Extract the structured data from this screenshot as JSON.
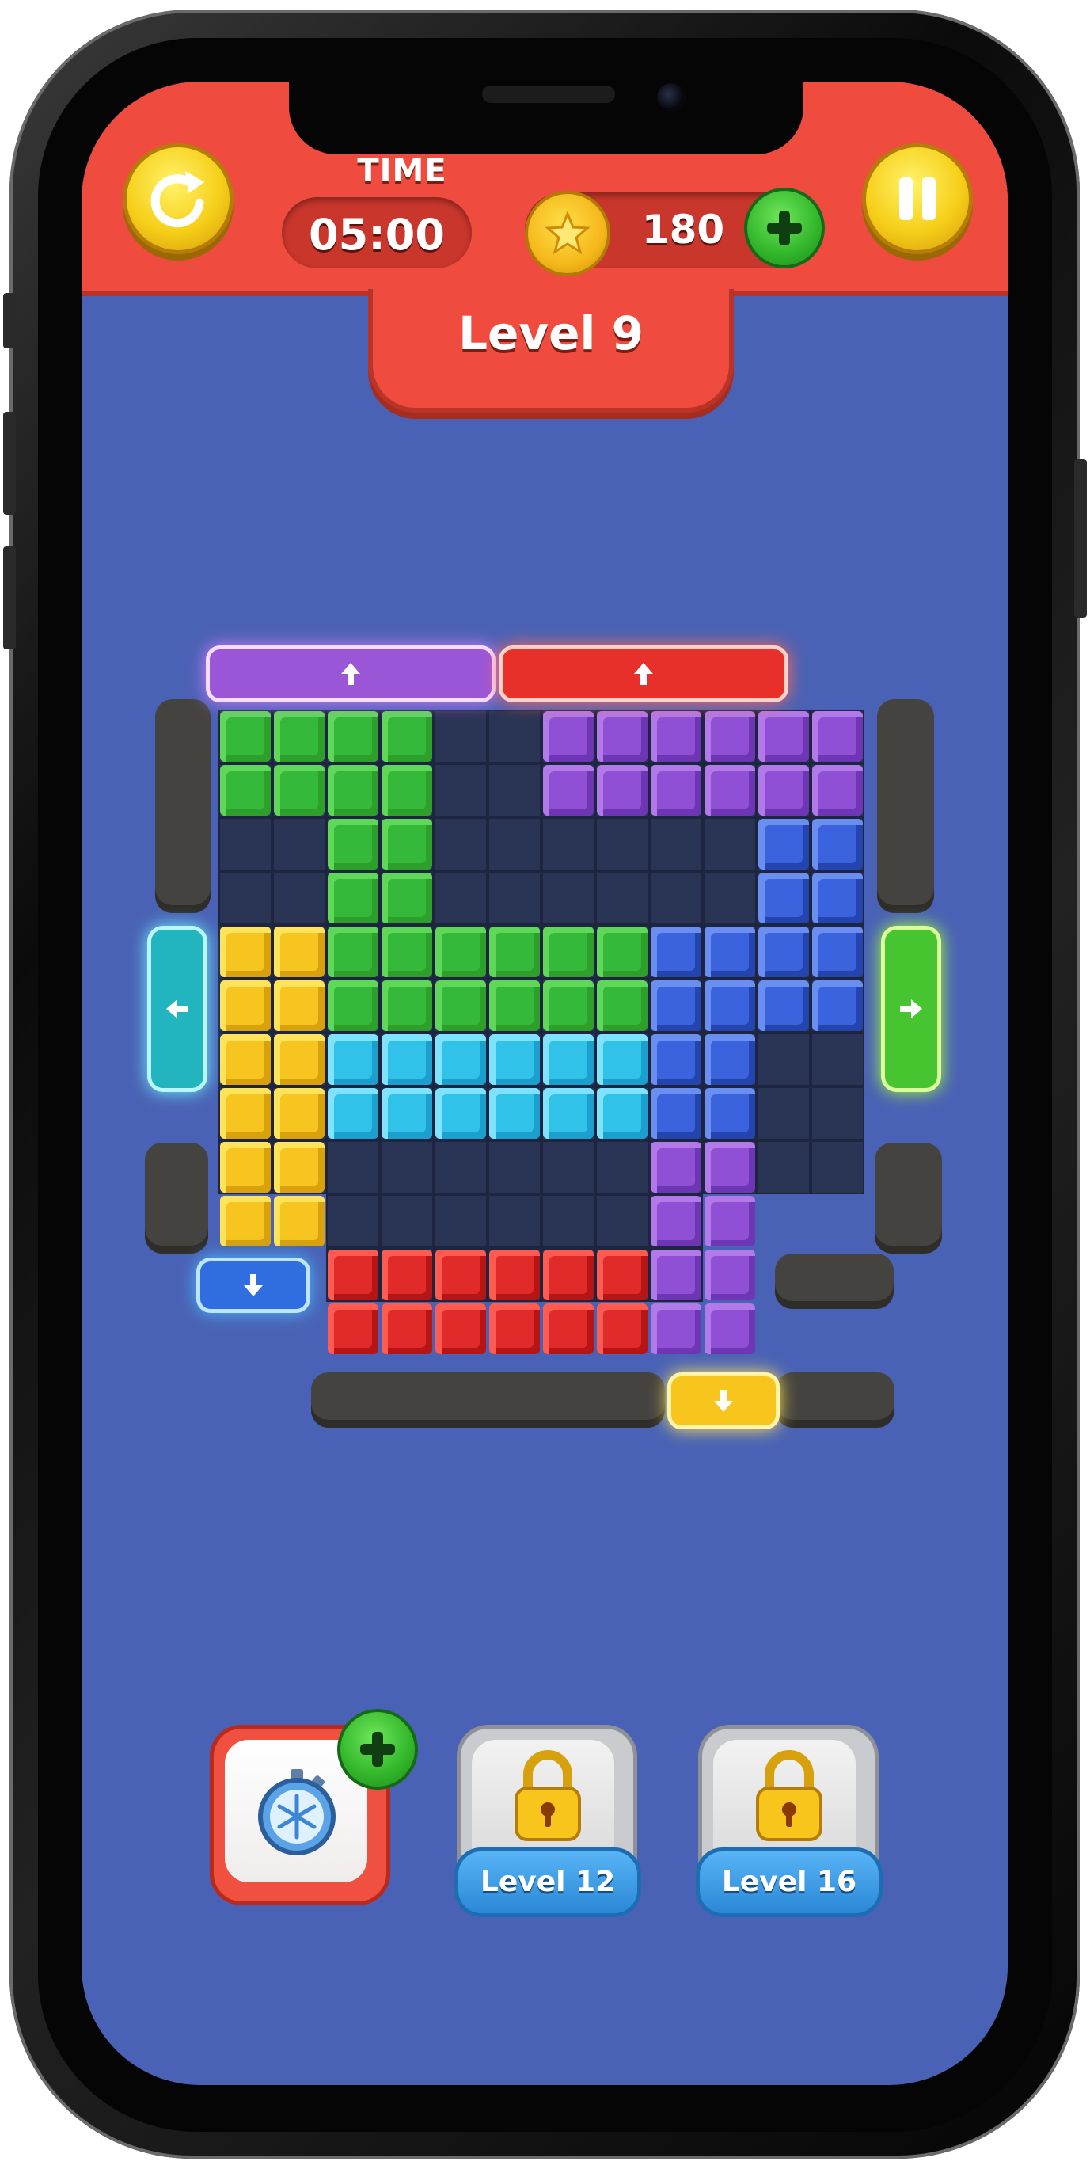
{
  "header": {
    "time_label": "TIME",
    "time_value": "05:00",
    "coins": "180",
    "level": "Level 9"
  },
  "board": {
    "exits": [
      {
        "side": "top",
        "color": "purple",
        "arrow": "up"
      },
      {
        "side": "top",
        "color": "red",
        "arrow": "up"
      },
      {
        "side": "left",
        "color": "cyan",
        "arrow": "left"
      },
      {
        "side": "right",
        "color": "green",
        "arrow": "right"
      },
      {
        "side": "bottom",
        "color": "blue",
        "arrow": "down"
      },
      {
        "side": "bottom",
        "color": "yellow",
        "arrow": "down"
      }
    ],
    "piece_colors": [
      "green",
      "purple",
      "blue",
      "yellow",
      "green",
      "cyan",
      "blue",
      "purple",
      "red"
    ]
  },
  "powerups": {
    "freeze": {
      "icon": "stopwatch-snowflake-icon"
    },
    "locked_1": {
      "label": "Level 12",
      "icon": "lock-icon"
    },
    "locked_2": {
      "label": "Level 16",
      "icon": "lock-icon"
    }
  },
  "colors": {
    "header": "#ef4b3f",
    "background": "#4a62b5",
    "green": "#35b93a",
    "purple": "#8f50d6",
    "blue": "#3a63dd",
    "yellow": "#f6c51f",
    "cyan": "#30c2e8",
    "red": "#e12a2a"
  }
}
